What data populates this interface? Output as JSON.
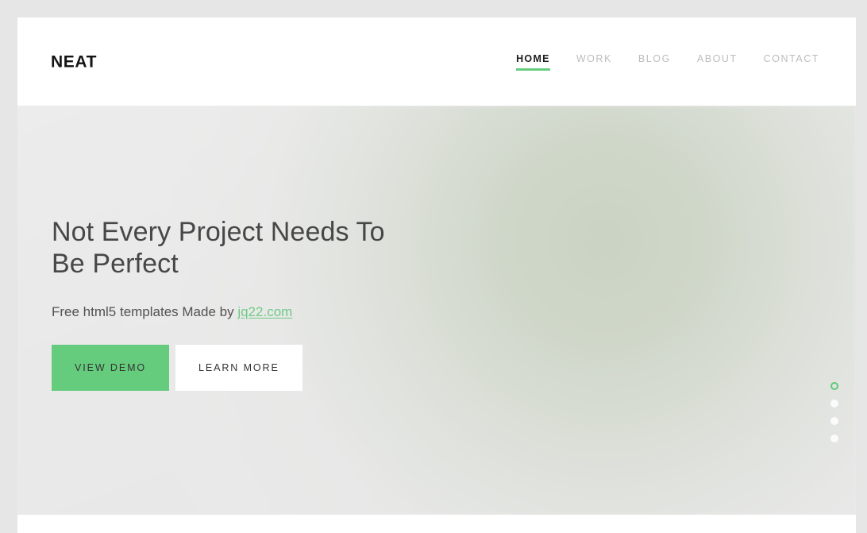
{
  "brand": {
    "name": "NEAT"
  },
  "nav": {
    "items": [
      {
        "label": "HOME",
        "active": true
      },
      {
        "label": "WORK",
        "active": false
      },
      {
        "label": "BLOG",
        "active": false
      },
      {
        "label": "ABOUT",
        "active": false
      },
      {
        "label": "CONTACT",
        "active": false
      }
    ]
  },
  "hero": {
    "title": "Not Every Project Needs To Be Perfect",
    "subtitle_prefix": "Free html5 templates Made by ",
    "subtitle_link": "jq22.com",
    "buttons": {
      "primary": "VIEW DEMO",
      "secondary": "LEARN MORE"
    }
  },
  "slider": {
    "dots": [
      {
        "index": "1",
        "active": true
      },
      {
        "index": "2",
        "active": false
      },
      {
        "index": "3",
        "active": false
      },
      {
        "index": "4",
        "active": false
      }
    ]
  },
  "colors": {
    "accent_green": "#66cc7d",
    "nav_inactive": "#bdbdbd",
    "nav_active": "#1b1b1b",
    "hero_bg": "#ebebeb",
    "page_bg": "#e6e6e6",
    "heading": "#474747",
    "link_green": "#6ecb87"
  }
}
